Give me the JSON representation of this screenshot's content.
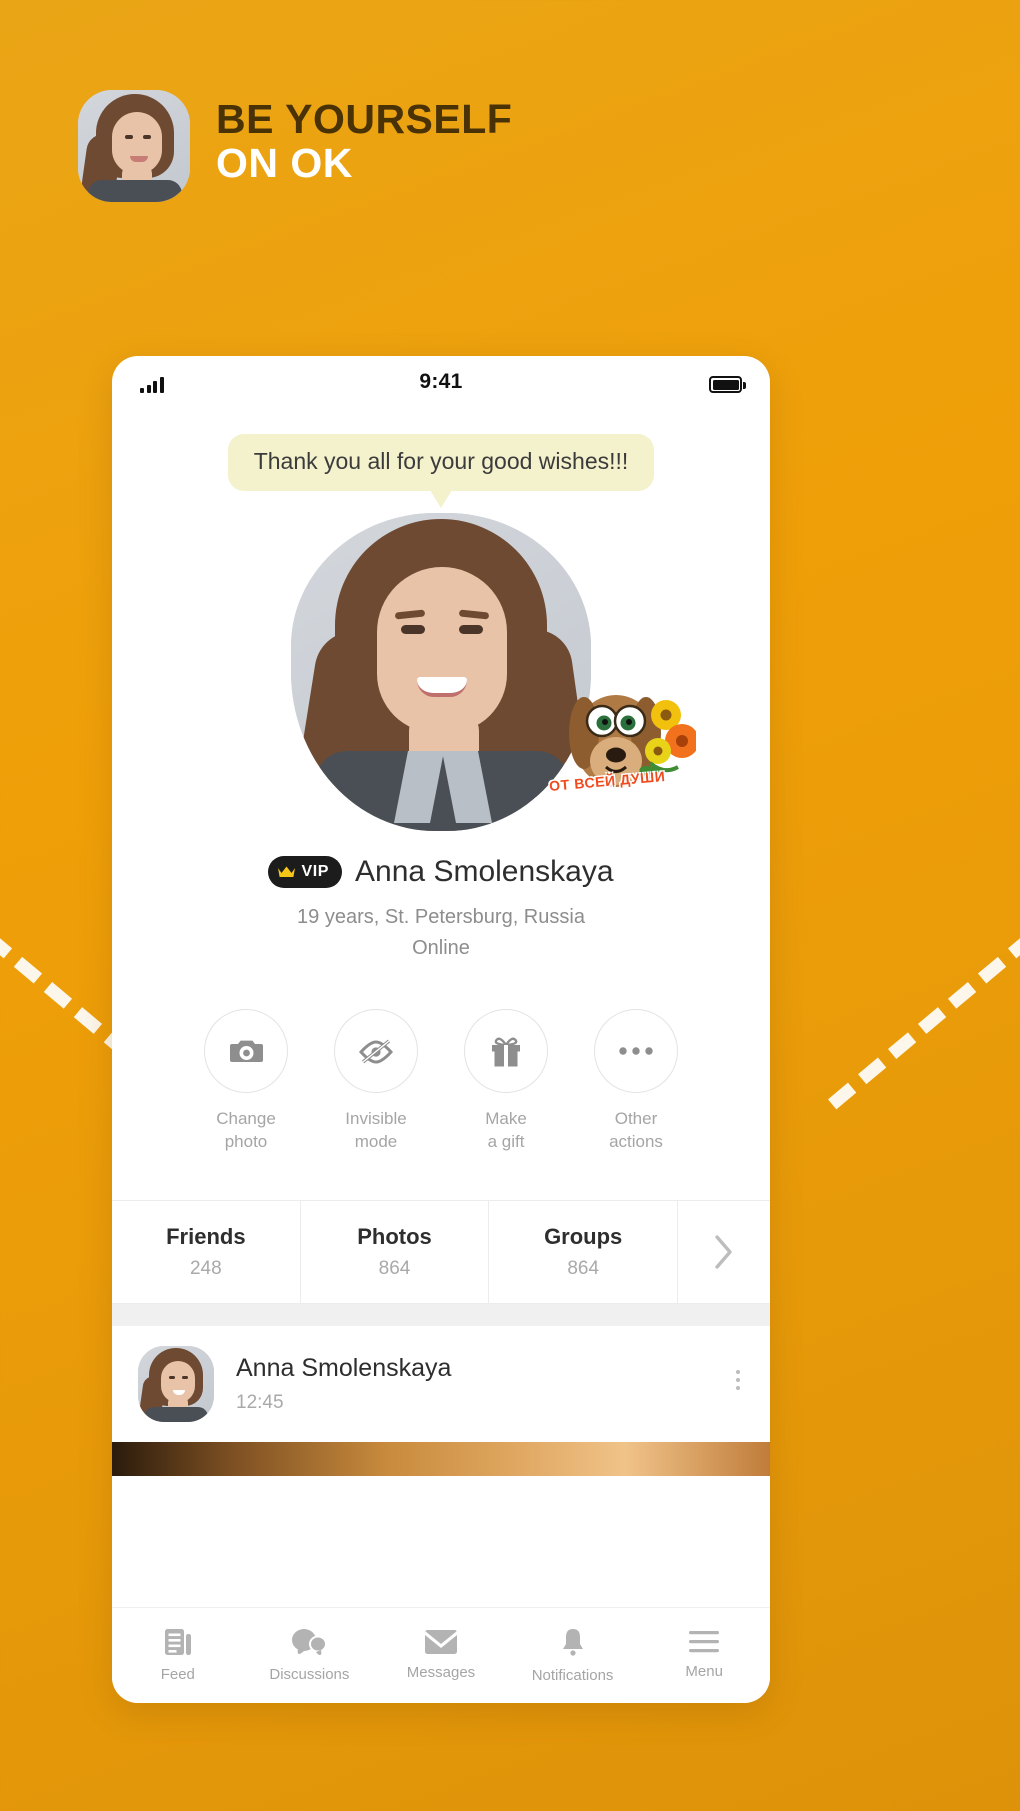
{
  "header": {
    "line1": "BE YOURSELF",
    "line2": "ON OK",
    "avatar_name": "profile-avatar"
  },
  "phone": {
    "statusbar": {
      "time": "9:41",
      "signal_icon": "signal-bars-icon",
      "battery_icon": "battery-full-icon"
    },
    "bubble": {
      "text": "Thank you all for your good wishes!!!"
    },
    "profile": {
      "sticker_text": "ОТ ВСЕЙ ДУШИ",
      "badge": "VIP",
      "badge_icon": "crown-icon",
      "name": "Anna Smolenskaya",
      "meta": "19 years, St. Petersburg, Russia",
      "status": "Online"
    },
    "actions": [
      {
        "icon": "camera-icon",
        "label_line1": "Change",
        "label_line2": "photo"
      },
      {
        "icon": "eye-slash-icon",
        "label_line1": "Invisible",
        "label_line2": "mode"
      },
      {
        "icon": "gift-icon",
        "label_line1": "Make",
        "label_line2": "a gift"
      },
      {
        "icon": "ellipsis-icon",
        "label_line1": "Other",
        "label_line2": "actions"
      }
    ],
    "stats": [
      {
        "label": "Friends",
        "value": "248"
      },
      {
        "label": "Photos",
        "value": "864"
      },
      {
        "label": "Groups",
        "value": "864"
      }
    ],
    "stats_more_icon": "chevron-right-icon",
    "feed": {
      "author": "Anna Smolenskaya",
      "time": "12:45",
      "menu_icon": "kebab-menu-icon"
    },
    "nav": [
      {
        "icon": "feed-icon",
        "label": "Feed"
      },
      {
        "icon": "discussions-icon",
        "label": "Discussions"
      },
      {
        "icon": "envelope-icon",
        "label": "Messages"
      },
      {
        "icon": "bell-icon",
        "label": "Notifications"
      },
      {
        "icon": "hamburger-icon",
        "label": "Menu"
      }
    ]
  },
  "colors": {
    "background_start": "#eaa516",
    "background_end": "#dd9209",
    "header_dark": "#4a3207",
    "header_light": "#ffffff",
    "bubble_bg": "#f4f1cd",
    "sticker_red": "#f04a1e",
    "vip_bg": "#1c1c1c",
    "crown_gold": "#f5c518"
  }
}
